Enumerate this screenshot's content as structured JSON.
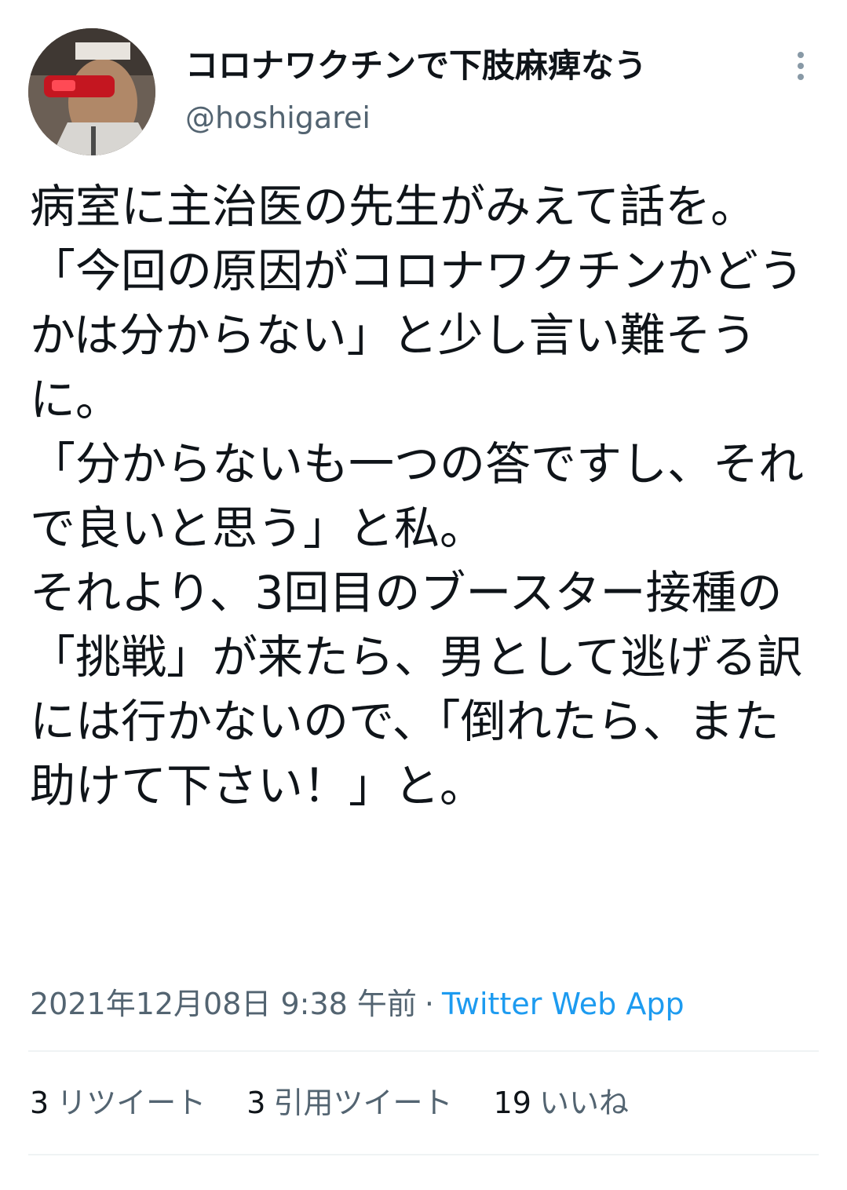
{
  "tweet": {
    "display_name": "コロナワクチンで下肢麻痺なう",
    "handle": "@hoshigarei",
    "text": "病室に主治医の先生がみえて話を。\n「今回の原因がコロナワクチンかどうかは分からない」と少し言い難そうに。\n「分からないも一つの答ですし、それで良いと思う」と私。\nそれより、3回目のブースター接種の「挑戦」が来たら、男として逃げる訳には行かないので、「倒れたら、また助けて下さい！」と。",
    "timestamp": "2021年12月08日 9:38 午前",
    "separator": "·",
    "source": "Twitter Web App",
    "stats": {
      "retweets_count": "3",
      "retweets_label": "リツイート",
      "quotes_count": "3",
      "quotes_label": "引用ツイート",
      "likes_count": "19",
      "likes_label": "いいね"
    }
  },
  "colors": {
    "text_primary": "#0f1419",
    "text_secondary": "#536471",
    "link": "#1d9bf0",
    "divider": "#eff3f4"
  },
  "icons": {
    "more": "more-vertical-icon"
  }
}
